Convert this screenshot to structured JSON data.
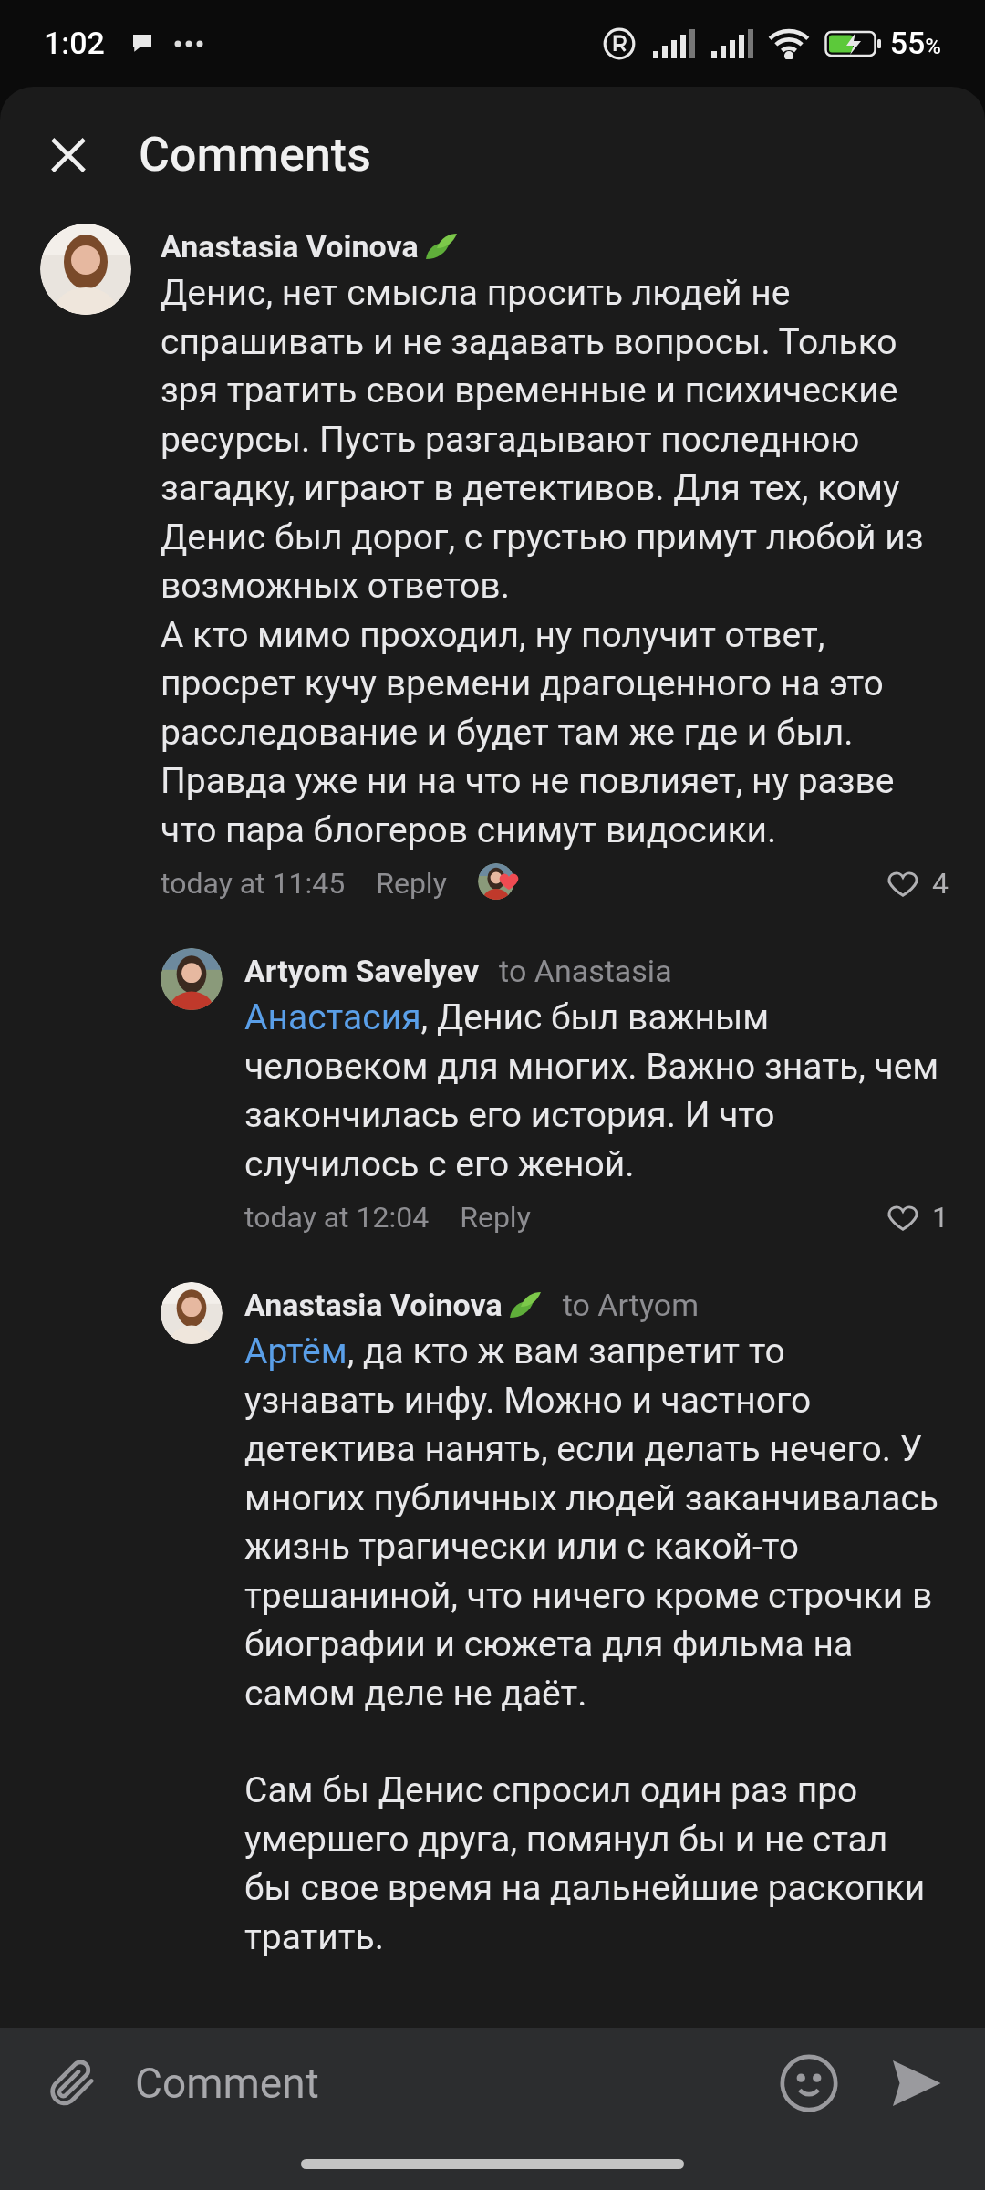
{
  "status_bar": {
    "time": "1:02",
    "battery": "55",
    "battery_unit": "%"
  },
  "header": {
    "title": "Comments"
  },
  "comments": [
    {
      "author": "Anastasia Voinova",
      "leaf_badge": true,
      "paragraphs": [
        "Денис, нет смысла просить людей не спрашивать и не задавать вопросы. Только зря тратить свои временные и психические ресурсы. Пусть разгадывают последнюю загадку, играют в детективов. Для тех, кому Денис был дорог, с грустью примут любой из возможных ответов.",
        "А кто мимо проходил, ну получит ответ, просрет кучу времени драгоценного на это расследование и будет там же где и был. Правда уже ни на что не повлияет, ну разве что пара блогеров снимут видосики."
      ],
      "time": "today at 11:45",
      "reply": "Reply",
      "reaction": true,
      "likes": "4",
      "replies": [
        {
          "author": "Artyom Savelyev",
          "leaf_badge": false,
          "to": "to Anastasia",
          "mention": "Анастасия",
          "paragraphs": [
            ", Денис был важным человеком для многих. Важно знать, чем закончилась его история. И что случилось с его женой."
          ],
          "time": "today at 12:04",
          "reply": "Reply",
          "reaction": false,
          "likes": "1"
        },
        {
          "author": "Anastasia Voinova",
          "leaf_badge": true,
          "to": "to Artyom",
          "mention": "Артём",
          "paragraphs": [
            ", да кто ж вам запретит то узнавать инфу. Можно и частного детектива нанять, если делать нечего. У многих публичных людей заканчивалась жизнь трагически или с какой-то трешаниной, что ничего кроме строчки в биографии и сюжета для фильма на самом деле не даёт.",
            "Сам бы Денис спросил один раз про умершего друга, помянул бы и не стал бы свое время на дальнейшие раскопки тратить."
          ]
        }
      ]
    }
  ],
  "composer": {
    "placeholder": "Comment"
  }
}
